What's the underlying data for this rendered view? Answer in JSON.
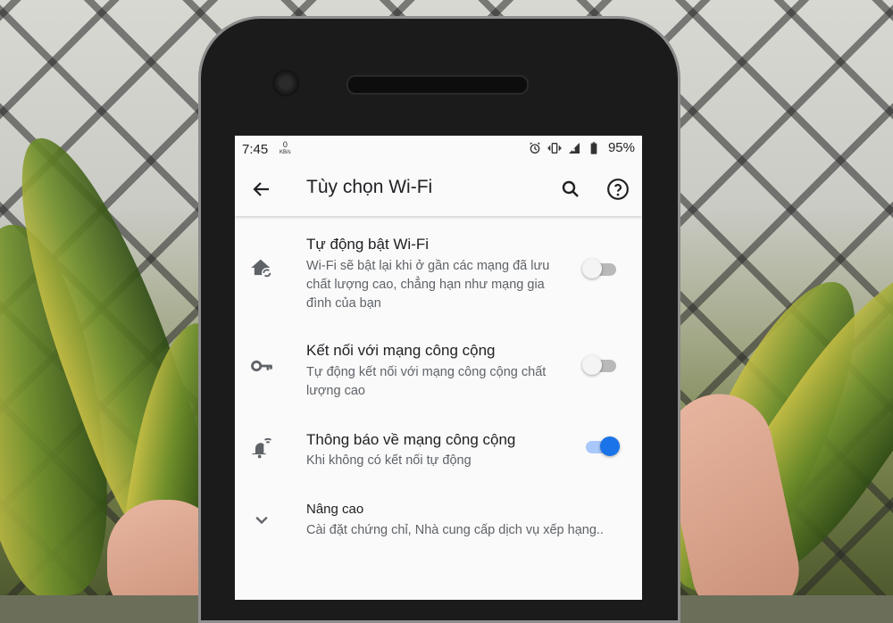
{
  "status_bar": {
    "time": "7:45",
    "speed_value": "0",
    "speed_unit": "KB/s",
    "battery": "95%",
    "icons": [
      "alarm-icon",
      "vibrate-icon",
      "signal-icon",
      "battery-icon"
    ]
  },
  "toolbar": {
    "title": "Tùy chọn Wi-Fi",
    "icons": [
      "back-arrow-icon",
      "search-icon",
      "help-icon"
    ]
  },
  "settings": [
    {
      "title": "Tự động bật Wi-Fi",
      "subtitle_lines": [
        "Wi-Fi sẽ bật lại khi ở gần các mạng đã lưu",
        "chất lượng cao, chẳng hạn như mạng gia",
        "đình của bạn"
      ],
      "icon": "wifi-home-auto-icon",
      "enabled": false
    },
    {
      "title": "Kết nối với mạng công cộng",
      "subtitle_lines": [
        "Tự động kết nối với mạng công cộng chất",
        "lượng cao"
      ],
      "icon": "key-icon",
      "enabled": false
    },
    {
      "title": "Thông báo về mạng công cộng",
      "subtitle_lines": [
        "Khi không có kết nối tự động"
      ],
      "icon": "notification-wifi-icon",
      "enabled": true
    },
    {
      "title": "Nâng cao",
      "subtitle_lines": [
        "Cài đặt chứng chỉ, Nhà cung cấp dịch vụ xếp hạng.."
      ],
      "icon": "chevron-down-icon"
    }
  ],
  "colors": {
    "accent": "#1a73e8",
    "text_primary": "#202124",
    "text_secondary": "#5f6368",
    "surface": "#fafafa"
  }
}
